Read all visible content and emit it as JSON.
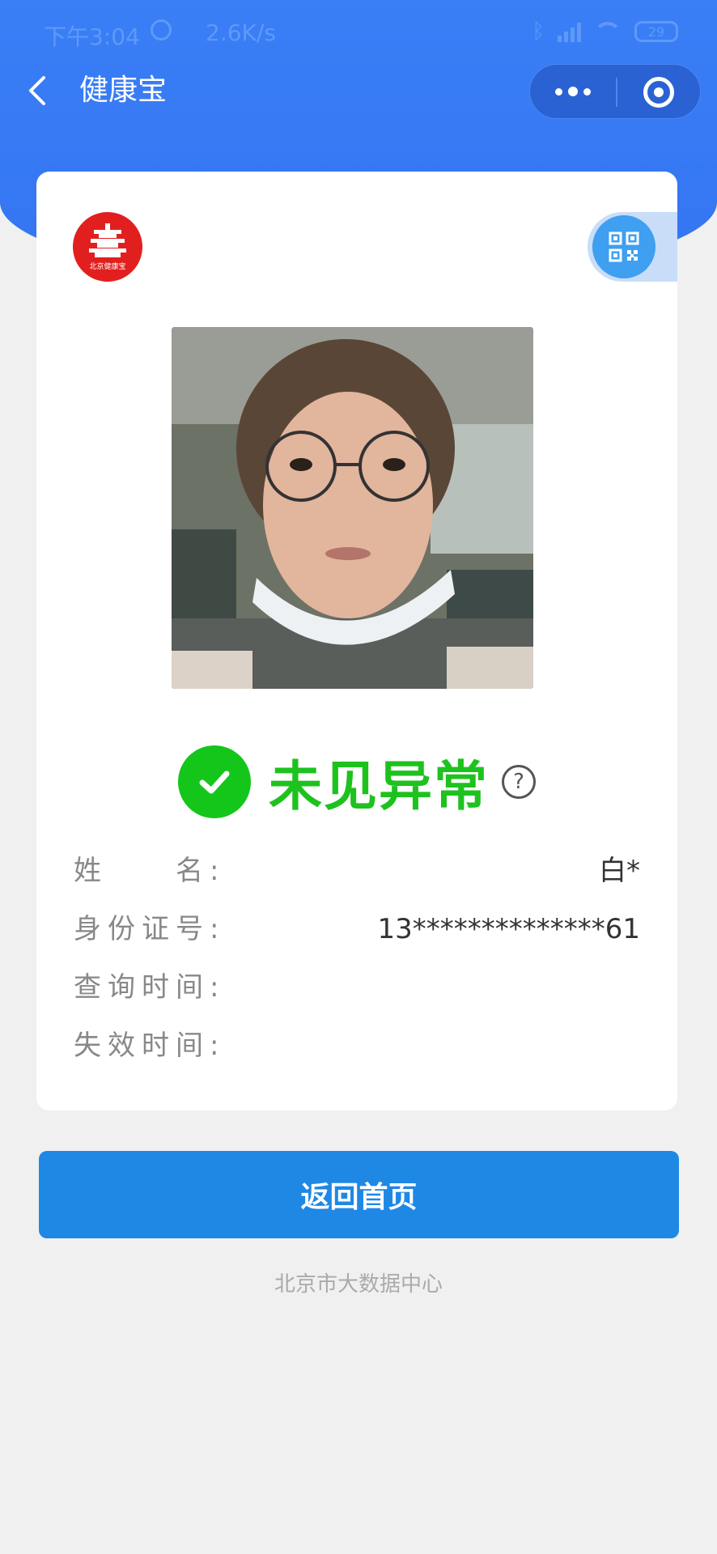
{
  "status_bar": {
    "time": "下午3:04",
    "speed": "2.6K/s",
    "battery": "29",
    "icons": [
      "alarm-icon",
      "bluetooth-icon",
      "signal-icon",
      "wifi-icon",
      "battery-icon"
    ]
  },
  "nav": {
    "title": "健康宝",
    "icons": [
      "back-arrow-icon",
      "more-dots-icon",
      "target-icon"
    ]
  },
  "card": {
    "logo_text": "北京健康宝",
    "status": "未见异常",
    "help_symbol": "?",
    "fields": [
      {
        "label": "姓　　名:",
        "value": "白*"
      },
      {
        "label": "身份证号:",
        "value": "13**************61"
      },
      {
        "label": "查询时间:",
        "value": ""
      },
      {
        "label": "失效时间:",
        "value": ""
      }
    ],
    "icons": [
      "qr-code-icon",
      "check-icon",
      "help-icon"
    ]
  },
  "button": {
    "label": "返回首页"
  },
  "footer": {
    "text": "北京市大数据中心"
  },
  "colors": {
    "header_blue": "#3a7ff6",
    "status_green": "#1ec21e",
    "button_blue": "#1f88e5",
    "logo_red": "#e21f1f"
  }
}
